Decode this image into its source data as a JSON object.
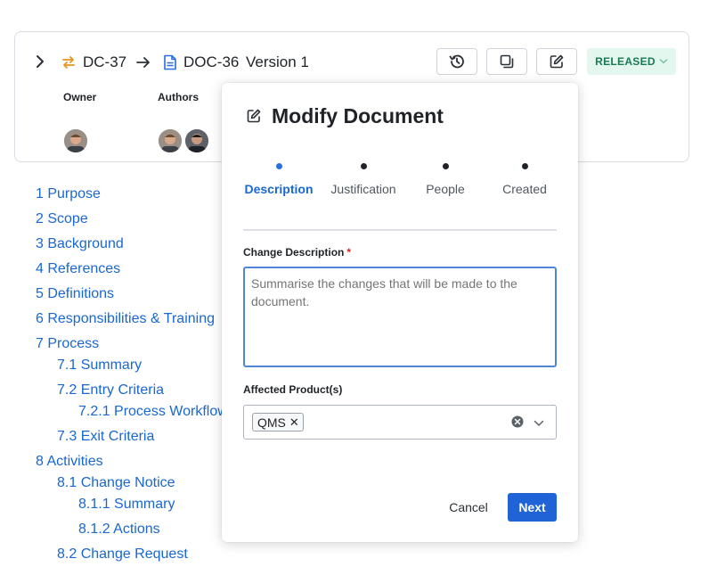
{
  "header": {
    "change_id": "DC-37",
    "document_id": "DOC-36",
    "version": "Version 1",
    "status": "RELEASED",
    "owner_label": "Owner",
    "authors_label": "Authors",
    "colors": {
      "change_icon": "#e8941f",
      "doc_icon": "#2a6ee0",
      "status_bg": "#e3f7ee",
      "status_text": "#1c7a51"
    }
  },
  "toc": [
    {
      "label": "1 Purpose",
      "level": 1
    },
    {
      "label": "2 Scope",
      "level": 1
    },
    {
      "label": "3 Background",
      "level": 1
    },
    {
      "label": "4 References",
      "level": 1
    },
    {
      "label": "5 Definitions",
      "level": 1
    },
    {
      "label": "6 Responsibilities & Training",
      "level": 1
    },
    {
      "label": "7 Process",
      "level": 1
    },
    {
      "label": "7.1 Summary",
      "level": 2
    },
    {
      "label": "7.2 Entry Criteria",
      "level": 2
    },
    {
      "label": "7.2.1 Process Workflow",
      "level": 3
    },
    {
      "label": "7.3 Exit Criteria",
      "level": 2
    },
    {
      "label": "8 Activities",
      "level": 1
    },
    {
      "label": "8.1 Change Notice",
      "level": 2
    },
    {
      "label": "8.1.1 Summary",
      "level": 3
    },
    {
      "label": "8.1.2 Actions",
      "level": 3
    },
    {
      "label": "8.2 Change Request",
      "level": 2
    }
  ],
  "modal": {
    "title": "Modify Document",
    "steps": [
      {
        "label": "Description",
        "active": true
      },
      {
        "label": "Justification",
        "active": false
      },
      {
        "label": "People",
        "active": false
      },
      {
        "label": "Created",
        "active": false
      }
    ],
    "change_description_label": "Change Description",
    "required_mark": "*",
    "change_description_placeholder": "Summarise the changes that will be made to the document.",
    "affected_products_label": "Affected Product(s)",
    "selected_products": [
      "QMS"
    ],
    "chip_remove": "✕",
    "cancel_label": "Cancel",
    "next_label": "Next",
    "colors": {
      "primary": "#1f63d7",
      "focus_border": "#4f86d6"
    }
  }
}
